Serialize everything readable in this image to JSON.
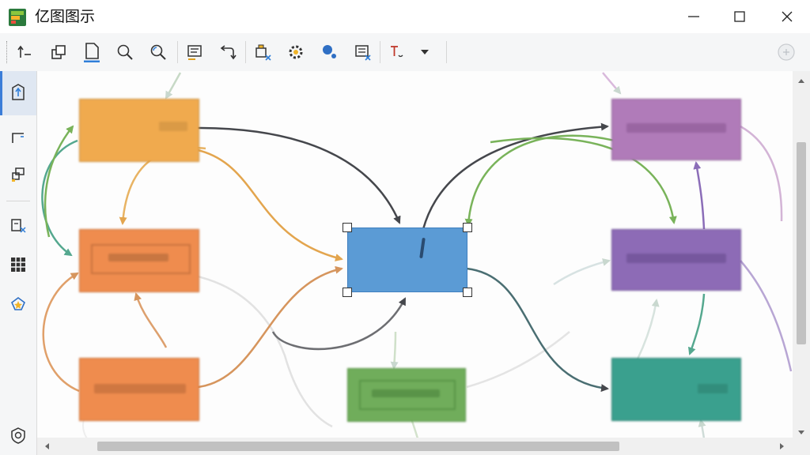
{
  "window": {
    "title": "亿图图示",
    "minimize_icon": "minimize-icon",
    "maximize_icon": "maximize-icon",
    "close_icon": "close-icon"
  },
  "toolbar": {
    "tools": [
      "insert-above-icon",
      "copy-style-icon",
      "page-icon",
      "zoom-out-icon",
      "zoom-in-icon",
      "text-list-icon",
      "connector-icon",
      "clear-format-icon",
      "settings-gear-icon",
      "pin-marker-icon",
      "delete-table-icon",
      "text-tool-icon",
      "dropdown-arrow-icon"
    ],
    "right_icon": "circle-plus-icon"
  },
  "leftbar": {
    "tools": [
      "upload-page-icon",
      "connector-bend-icon",
      "group-shapes-icon",
      "paste-format-icon",
      "grid-layout-icon",
      "star-marker-icon",
      "shield-badge-icon"
    ]
  },
  "colors": {
    "orange_light": "#f0aa4e",
    "orange": "#ef8c4e",
    "blue": "#5b9bd5",
    "green": "#70ad5b",
    "purple": "#b07bb9",
    "violet": "#8d6bb6",
    "teal": "#3aa08e"
  }
}
